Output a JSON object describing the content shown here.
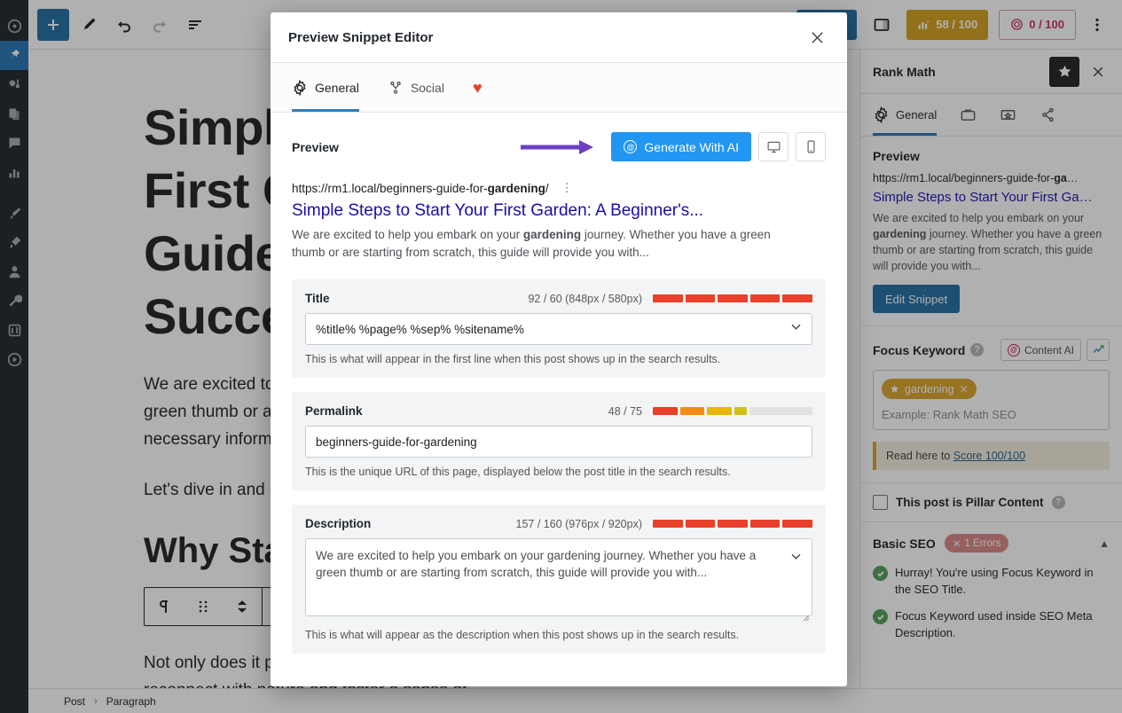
{
  "admin_bar": {
    "items": [
      {
        "name": "dashboard-icon"
      },
      {
        "name": "posts-pin-icon",
        "active": true
      },
      {
        "name": "media-icon"
      },
      {
        "name": "pages-icon"
      },
      {
        "name": "comments-icon"
      },
      {
        "name": "analytics-icon"
      },
      {
        "name": "appearance-brush-icon"
      },
      {
        "name": "plugins-icon"
      },
      {
        "name": "users-icon"
      },
      {
        "name": "tools-wrench-icon"
      },
      {
        "name": "settings-sliders-icon"
      },
      {
        "name": "play-circle-icon"
      }
    ]
  },
  "editor_header": {
    "add_block_label": "+",
    "tools": [
      "pencil-icon",
      "undo-icon",
      "redo-icon",
      "list-view-icon"
    ],
    "publish_label": "",
    "seo_score": "58 / 100",
    "content_ai_score": "0 / 100",
    "sidebar_toggle": "sidebar-toggle-icon",
    "options": "more-options-icon"
  },
  "post": {
    "title": "Simple Steps to Start Your First Garden: A Beginner's Guide to Gardening Success",
    "paragraph1": "We are excited to help you embark on your gardening journey. Whether you have a green thumb or are starting from scratch, this guide will provide you with the necessary information.",
    "paragraph2": "Let's dive in and discover the joys of gardening.",
    "heading2": "Why Start a Garden?",
    "paragraph3": "Not only does it provide fresh produce for your table, but it also allows you to reconnect with nature and foster a sense of"
  },
  "breadcrumb": {
    "post": "Post",
    "separator": "›",
    "block": "Paragraph"
  },
  "sidebar": {
    "title": "Rank Math",
    "tabs": [
      {
        "label": "General",
        "icon": "gear-icon",
        "active": true
      },
      {
        "label": "",
        "icon": "briefcase-icon",
        "active": false
      },
      {
        "label": "",
        "icon": "social-image-icon",
        "active": false
      },
      {
        "label": "",
        "icon": "schema-icon",
        "active": false
      }
    ],
    "preview": {
      "heading": "Preview",
      "url": "https://rm1.local/beginners-guide-for-ga…",
      "title": "Simple Steps to Start Your First Ga…",
      "description_prefix": "We are excited to help you embark on your ",
      "description_bold": "gardening",
      "description_suffix": " journey. Whether you have a green thumb or are starting from scratch, this guide will provide you with...",
      "edit_button": "Edit Snippet"
    },
    "focus_keyword": {
      "label": "Focus Keyword",
      "content_ai_button": "Content AI",
      "tag": "gardening",
      "placeholder": "Example: Rank Math SEO",
      "note_prefix": "Read here to ",
      "note_link": "Score 100/100"
    },
    "pillar": {
      "label": "This post is Pillar Content"
    },
    "basic_seo": {
      "title": "Basic SEO",
      "errors_badge": "1 Errors",
      "items": [
        "Hurray! You're using Focus Keyword in the SEO Title.",
        "Focus Keyword used inside SEO Meta Description."
      ]
    }
  },
  "modal": {
    "title": "Preview Snippet Editor",
    "tabs": [
      {
        "label": "General",
        "icon": "gear-icon",
        "active": true
      },
      {
        "label": "Social",
        "icon": "share-icon",
        "active": false
      },
      {
        "label": "",
        "icon": "heart-icon",
        "active": false
      }
    ],
    "preview": {
      "heading": "Preview",
      "generate_button": "Generate With AI",
      "desktop_icon": "desktop-icon",
      "mobile_icon": "mobile-icon",
      "url_prefix": "https://rm1.local/beginners-guide-for-",
      "url_bold": "gardening",
      "url_suffix": "/",
      "title": "Simple Steps to Start Your First Garden: A Beginner's...",
      "desc_part1": "We are excited to help you embark on your ",
      "desc_bold": "gardening",
      "desc_part2": " journey. Whether you have a green thumb or are starting from scratch, this guide will provide you with..."
    },
    "fields": {
      "title": {
        "label": "Title",
        "count": "92 / 60 (848px / 580px)",
        "value": "%title% %page% %sep% %sitename%",
        "hint": "This is what will appear in the first line when this post shows up in the search results.",
        "progress_colors": [
          "#e8402a",
          "#e8402a",
          "#e8402a",
          "#e8402a",
          "#e8402a"
        ]
      },
      "permalink": {
        "label": "Permalink",
        "count": "48 / 75",
        "value": "beginners-guide-for-gardening",
        "hint": "This is the unique URL of this page, displayed below the post title in the search results.",
        "progress_colors": [
          "#e8402a",
          "#f58a16",
          "#e8b709",
          "#cfc016",
          "#e2e2e2"
        ]
      },
      "description": {
        "label": "Description",
        "count": "157 / 160 (976px / 920px)",
        "value": "We are excited to help you embark on your gardening journey. Whether you have a green thumb or are starting from scratch, this guide will provide you with...",
        "hint": "This is what will appear as the description when this post shows up in the search results.",
        "progress_colors": [
          "#e8402a",
          "#e8402a",
          "#e8402a",
          "#e8402a",
          "#e8402a"
        ]
      }
    }
  },
  "colors": {
    "accent_blue": "#2196f3",
    "wp_blue": "#1e6ba1",
    "gold": "#d29e19",
    "pink": "#c62a6a",
    "red": "#e8402a",
    "green": "#4f9d54",
    "arrow_purple": "#6b3fc4"
  }
}
